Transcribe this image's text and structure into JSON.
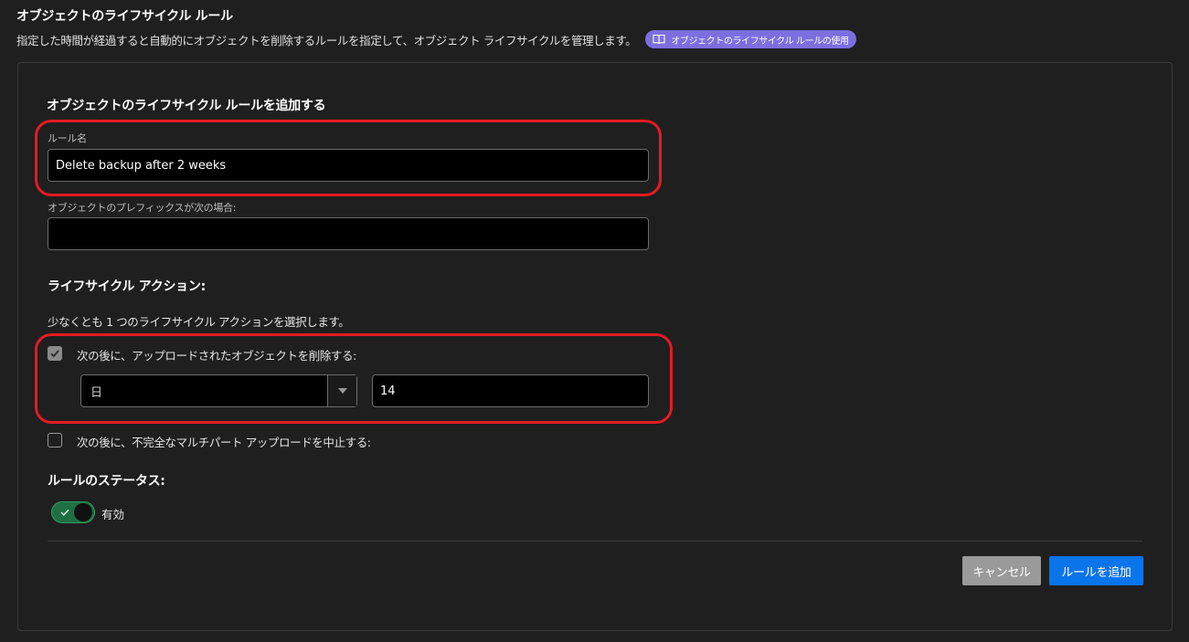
{
  "header": {
    "title": "オブジェクトのライフサイクル ルール",
    "description": "指定した時間が経過すると自動的にオブジェクトを削除するルールを指定して、オブジェクト ライフサイクルを管理します。",
    "help_link": "オブジェクトのライフサイクル ルールの使用",
    "help_icon": "book-icon"
  },
  "form": {
    "title": "オブジェクトのライフサイクル ルールを追加する",
    "rule_name": {
      "label": "ルール名",
      "value": "Delete backup after 2 weeks"
    },
    "prefix": {
      "label": "オブジェクトのプレフィックスが次の場合:",
      "value": ""
    },
    "actions": {
      "title": "ライフサイクル アクション:",
      "hint": "少なくとも 1 つのライフサイクル アクションを選択します。",
      "delete_after": {
        "label": "次の後に、アップロードされたオブジェクトを削除する:",
        "checked": true,
        "unit": "日",
        "amount": "14"
      },
      "abort_multipart": {
        "label": "次の後に、不完全なマルチパート アップロードを中止する:",
        "checked": false
      }
    },
    "status": {
      "title": "ルールのステータス:",
      "toggle_label": "有効",
      "enabled": true
    }
  },
  "buttons": {
    "cancel": "キャンセル",
    "add": "ルールを追加"
  },
  "colors": {
    "accent": "#0a74ea",
    "highlight": "#e41b23",
    "toggle_on": "#1e6f43",
    "pill": "#7b6fe0"
  }
}
